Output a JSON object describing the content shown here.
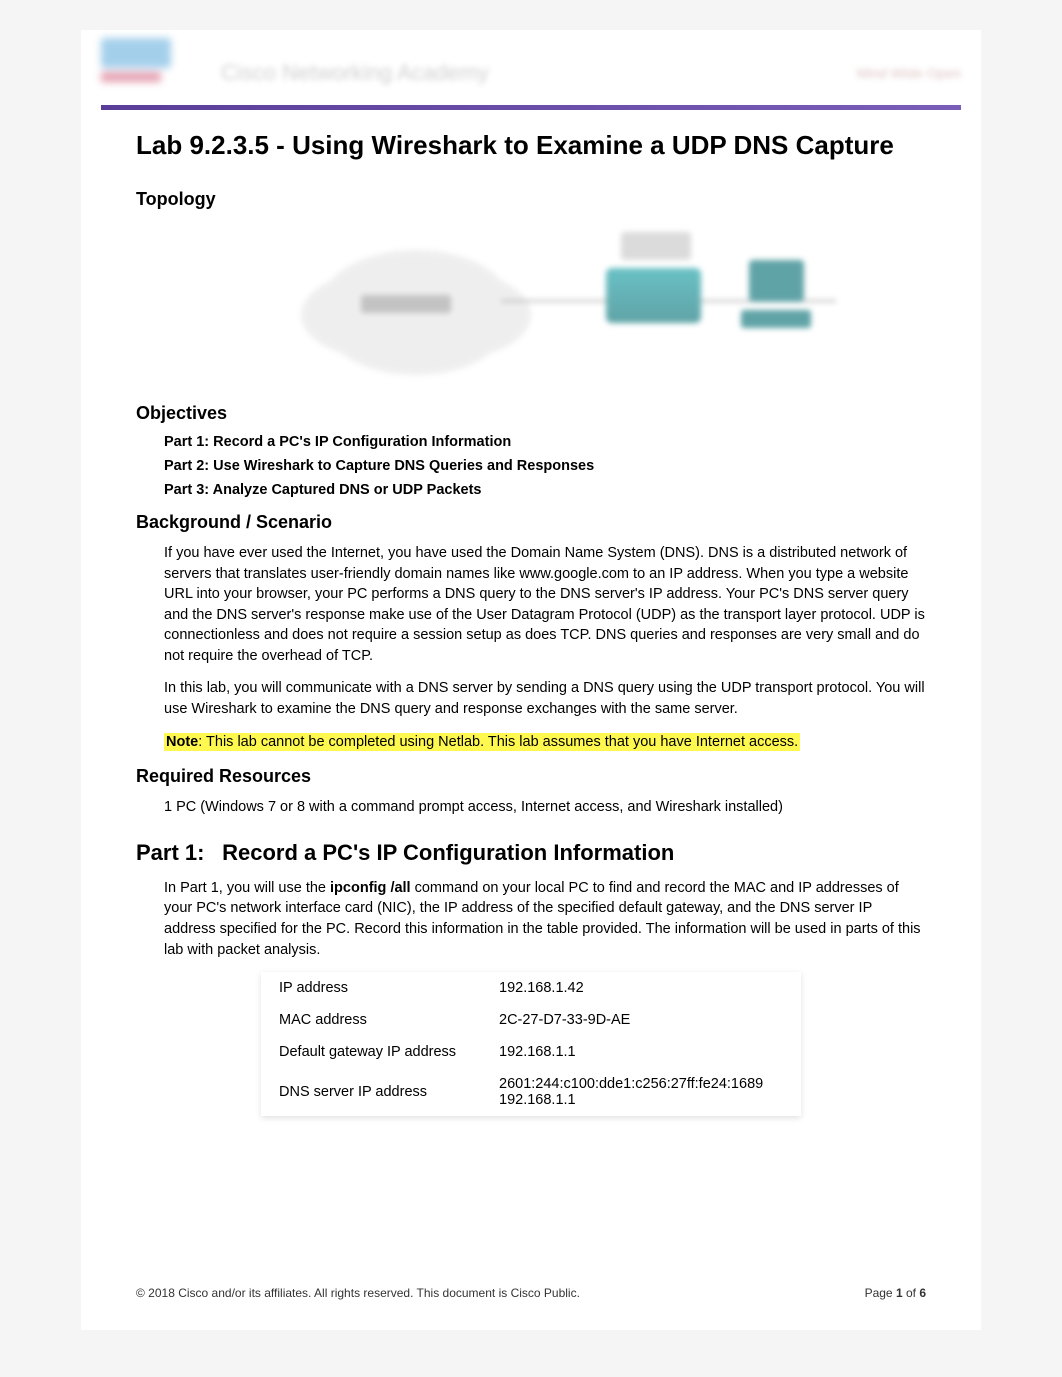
{
  "header": {
    "brand_title": "Cisco Networking Academy",
    "right_text": "Mind Wide Open"
  },
  "title": "Lab 9.2.3.5 - Using Wireshark to Examine a UDP DNS Capture",
  "sections": {
    "topology_heading": "Topology",
    "objectives_heading": "Objectives",
    "objectives": [
      "Part 1: Record a PC's IP Configuration Information",
      "Part 2: Use Wireshark to Capture DNS Queries and Responses",
      "Part 3: Analyze Captured DNS or UDP Packets"
    ],
    "background_heading": "Background / Scenario",
    "background_p1": "If you have ever used the Internet, you have used the Domain Name System (DNS). DNS is a distributed network of servers that translates user-friendly domain names like www.google.com to an IP address. When you type a website URL into your browser, your PC performs a DNS query to the DNS server's IP address. Your PC's DNS server query and the DNS server's response make use of the User Datagram Protocol (UDP) as the transport layer protocol. UDP is connectionless and does not require a session setup as does TCP. DNS queries and responses are very small and do not require the overhead of TCP.",
    "background_p2": "In this lab, you will communicate with a DNS server by sending a DNS query using the UDP transport protocol. You will use Wireshark to examine the DNS query and response exchanges with the same server.",
    "note_label": "Note",
    "note_text": ": This lab cannot be completed using Netlab. This lab assumes that you have Internet access.",
    "required_heading": "Required Resources",
    "required_text": "1 PC (Windows 7 or 8 with a command prompt access, Internet access, and Wireshark installed)",
    "part1_num": "Part 1:",
    "part1_title": "Record a PC's IP Configuration Information",
    "part1_intro_pre": "In Part 1, you will use the ",
    "part1_cmd": "ipconfig /all",
    "part1_intro_post": " command on your local PC to find and record the MAC and IP addresses of your PC's network interface card (NIC), the IP address of the specified default gateway, and the DNS server IP address specified for the PC. Record this information in the table provided. The information will be used in parts of this lab with packet analysis."
  },
  "table": {
    "rows": [
      {
        "label": "IP address",
        "value": "192.168.1.42"
      },
      {
        "label": "MAC address",
        "value": "2C-27-D7-33-9D-AE"
      },
      {
        "label": "Default gateway IP address",
        "value": "192.168.1.1"
      },
      {
        "label": "DNS server IP address",
        "value": "2601:244:c100:dde1:c256:27ff:fe24:1689\n192.168.1.1"
      }
    ]
  },
  "footer": {
    "copyright": "© 2018 Cisco and/or its affiliates. All rights reserved. This document is Cisco Public.",
    "page_label_pre": "Page ",
    "page_current": "1",
    "page_label_mid": " of ",
    "page_total": "6"
  }
}
